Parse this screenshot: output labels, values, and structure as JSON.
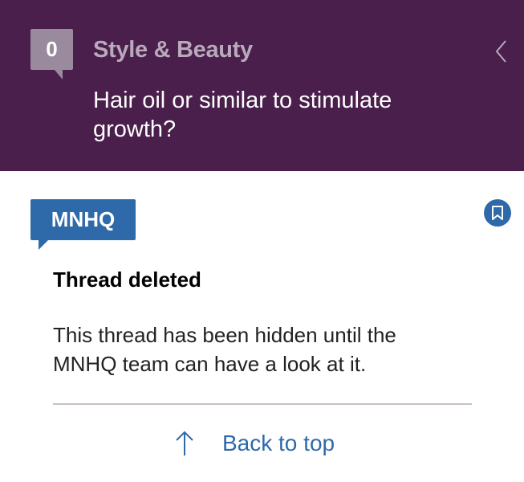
{
  "header": {
    "reply_count": "0",
    "category": "Style & Beauty",
    "thread_title": "Hair oil or similar to stimulate growth?"
  },
  "post": {
    "poster": "MNHQ",
    "heading": "Thread deleted",
    "body": "This thread has been hidden until the MNHQ team can have a look at it."
  },
  "footer": {
    "back_to_top": "Back to top"
  },
  "colors": {
    "header_bg": "#4a1f4c",
    "accent_blue": "#2e6aaa",
    "count_badge_bg": "#9a8a9d"
  },
  "icons": [
    "back-chevron-icon",
    "bookmark-icon",
    "up-arrow-icon"
  ]
}
